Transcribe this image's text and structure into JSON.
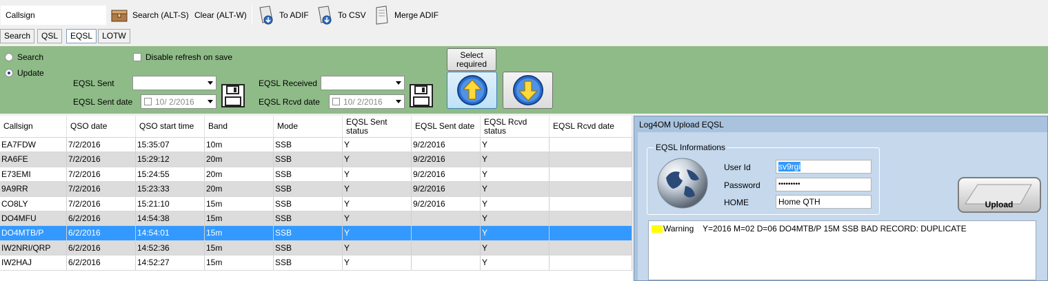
{
  "toolbar": {
    "callsign_value": "Callsign",
    "search_label": "Search (ALT-S)",
    "clear_label": "Clear (ALT-W)",
    "to_adif_label": "To ADIF",
    "to_csv_label": "To CSV",
    "merge_adif_label": "Merge ADIF"
  },
  "tabs": [
    {
      "label": "Search"
    },
    {
      "label": "QSL"
    },
    {
      "label": "EQSL"
    },
    {
      "label": "LOTW"
    }
  ],
  "filter": {
    "search_radio": "Search",
    "update_radio": "Update",
    "disable_refresh": "Disable refresh on save",
    "eqsl_sent_label": "EQSL Sent",
    "eqsl_sent_date_label": "EQSL Sent date",
    "eqsl_received_label": "EQSL Received",
    "eqsl_rcvd_date_label": "EQSL Rcvd date",
    "sent_date_value": "10/  2/2016",
    "rcvd_date_value": "10/  2/2016",
    "select_required": "Select required"
  },
  "grid": {
    "headers": [
      "Callsign",
      "QSO date",
      "QSO start time",
      "Band",
      "Mode",
      "EQSL Sent status",
      "EQSL Sent date",
      "EQSL Rcvd status",
      "EQSL Rcvd date"
    ],
    "rows": [
      [
        "EA7FDW",
        "7/2/2016",
        "15:35:07",
        "10m",
        "SSB",
        "Y",
        "9/2/2016",
        "Y",
        ""
      ],
      [
        "RA6FE",
        "7/2/2016",
        "15:29:12",
        "20m",
        "SSB",
        "Y",
        "9/2/2016",
        "Y",
        ""
      ],
      [
        "E73EMI",
        "7/2/2016",
        "15:24:55",
        "20m",
        "SSB",
        "Y",
        "9/2/2016",
        "Y",
        ""
      ],
      [
        "9A9RR",
        "7/2/2016",
        "15:23:33",
        "20m",
        "SSB",
        "Y",
        "9/2/2016",
        "Y",
        ""
      ],
      [
        "CO8LY",
        "7/2/2016",
        "15:21:10",
        "15m",
        "SSB",
        "Y",
        "9/2/2016",
        "Y",
        ""
      ],
      [
        "DO4MFU",
        "6/2/2016",
        "14:54:38",
        "15m",
        "SSB",
        "Y",
        "",
        "Y",
        ""
      ],
      [
        "DO4MTB/P",
        "6/2/2016",
        "14:54:01",
        "15m",
        "SSB",
        "Y",
        "",
        "Y",
        ""
      ],
      [
        "IW2NRI/QRP",
        "6/2/2016",
        "14:52:36",
        "15m",
        "SSB",
        "Y",
        "",
        "Y",
        ""
      ],
      [
        "IW2HAJ",
        "6/2/2016",
        "14:52:27",
        "15m",
        "SSB",
        "Y",
        "",
        "Y",
        ""
      ]
    ],
    "selected_row": 6
  },
  "dialog": {
    "title": "Log4OM Upload EQSL",
    "group_title": "EQSL Informations",
    "user_id_label": "User Id",
    "user_id_value": "sv9rgi",
    "password_label": "Password",
    "password_value": "•••••••••",
    "home_label": "HOME",
    "home_value": "Home QTH",
    "upload_label": "Upload",
    "log_level": "Warning",
    "log_message": "Y=2016 M=02 D=06 DO4MTB/P 15M SSB BAD RECORD: DUPLICATE"
  },
  "icons": {
    "search": "search-chest-icon",
    "to_adif": "export-adif-icon",
    "to_csv": "export-csv-icon",
    "merge": "merge-adif-icon",
    "save": "floppy-disk-icon",
    "upload_arrow": "arrow-up-icon",
    "download_arrow": "arrow-down-icon",
    "globe": "globe-icon"
  }
}
